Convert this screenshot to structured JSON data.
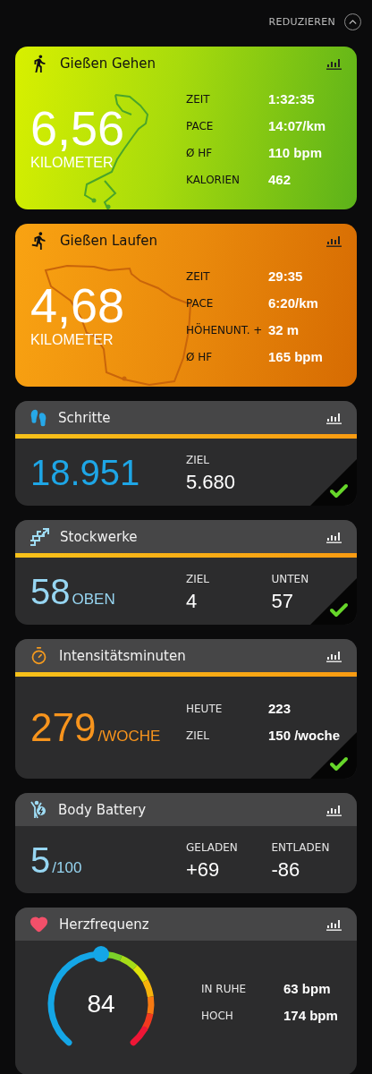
{
  "header": {
    "collapse_label": "REDUZIEREN"
  },
  "activities": [
    {
      "kind": "walk",
      "title": "Gießen Gehen",
      "distance": "6,56",
      "unit": "KILOMETER",
      "stats": [
        {
          "label": "ZEIT",
          "value": "1:32:35"
        },
        {
          "label": "PACE",
          "value": "14:07/km"
        },
        {
          "label": "Ø HF",
          "value": "110 bpm"
        },
        {
          "label": "KALORIEN",
          "value": "462"
        }
      ]
    },
    {
      "kind": "run",
      "title": "Gießen Laufen",
      "distance": "4,68",
      "unit": "KILOMETER",
      "stats": [
        {
          "label": "ZEIT",
          "value": "29:35"
        },
        {
          "label": "PACE",
          "value": "6:20/km"
        },
        {
          "label": "HÖHENUNT. +",
          "value": "32 m"
        },
        {
          "label": "Ø HF",
          "value": "165 bpm"
        }
      ]
    }
  ],
  "widgets": [
    {
      "kind": "steps",
      "title": "Schritte",
      "main": "18.951",
      "level": 1,
      "goal_reached": true,
      "stats": [
        {
          "label": "ZIEL",
          "value": "5.680"
        }
      ]
    },
    {
      "kind": "floors",
      "title": "Stockwerke",
      "main": "58",
      "main_unit": "OBEN",
      "level": 1,
      "goal_reached": true,
      "stats": [
        {
          "label": "ZIEL",
          "value": "4"
        },
        {
          "label": "UNTEN",
          "value": "57"
        }
      ]
    },
    {
      "kind": "intensity",
      "title": "Intensitätsminuten",
      "main": "279",
      "main_unit": "/WOCHE",
      "level": 1,
      "goal_reached": true,
      "stats": [
        {
          "label": "HEUTE",
          "value": "223"
        },
        {
          "label": "ZIEL",
          "value": "150 /woche"
        }
      ]
    },
    {
      "kind": "battery",
      "title": "Body Battery",
      "main": "5",
      "main_unit": "/100",
      "goal_reached": false,
      "stats": [
        {
          "label": "GELADEN",
          "value": "+69"
        },
        {
          "label": "ENTLADEN",
          "value": "-86"
        }
      ]
    },
    {
      "kind": "heart",
      "title": "Herzfrequenz",
      "main": "84",
      "goal_reached": false,
      "stats": [
        {
          "label": "IN RUHE",
          "value": "63 bpm"
        },
        {
          "label": "HOCH",
          "value": "174 bpm"
        }
      ]
    }
  ]
}
